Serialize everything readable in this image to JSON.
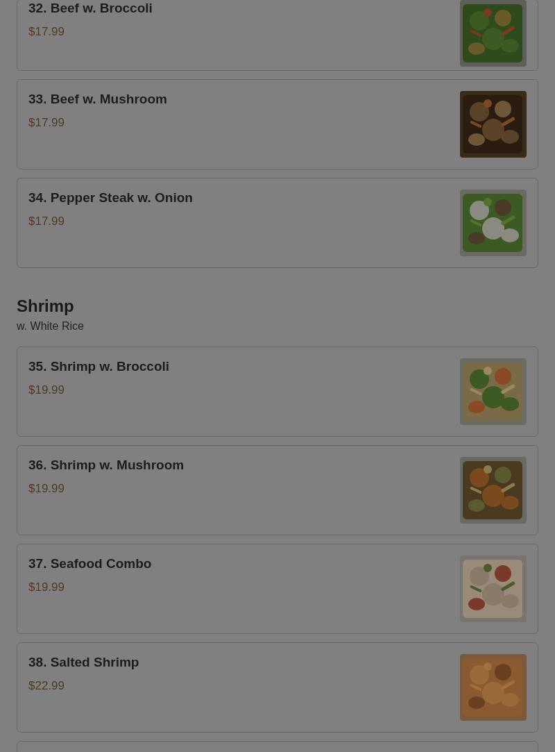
{
  "sections": [
    {
      "items": [
        {
          "kind": "dish",
          "name": "32. Beef w. Broccoli",
          "price": "$17.99"
        },
        {
          "kind": "dish",
          "name": "33. Beef w. Mushroom",
          "price": "$17.99"
        },
        {
          "kind": "dish",
          "name": "34. Pepper Steak w. Onion",
          "price": "$17.99"
        }
      ]
    },
    {
      "title": "Shrimp",
      "subtitle": "w. White Rice",
      "items": [
        {
          "kind": "dish",
          "name": "35. Shrimp w. Broccoli",
          "price": "$19.99"
        },
        {
          "kind": "dish",
          "name": "36. Shrimp w. Mushroom",
          "price": "$19.99"
        },
        {
          "kind": "dish",
          "name": "37. Seafood Combo",
          "price": "$19.99"
        },
        {
          "kind": "dish",
          "name": "38. Salted Shrimp",
          "price": "$22.99"
        },
        {
          "kind": "cut_off"
        }
      ]
    }
  ]
}
